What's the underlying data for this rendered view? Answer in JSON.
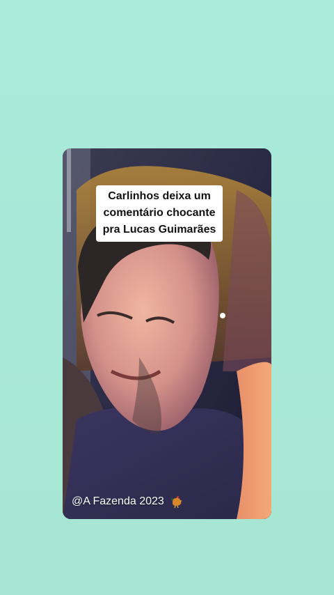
{
  "video": {
    "caption_lines": [
      "Carlinhos deixa um",
      "comentário chocante",
      "pra Lucas Guimarães"
    ],
    "watermark": "@A Fazenda 2023",
    "watermark_icon": "rooster-icon"
  },
  "colors": {
    "background": "#a8e8d4",
    "caption_bg": "#ffffff",
    "caption_text": "#111111"
  }
}
